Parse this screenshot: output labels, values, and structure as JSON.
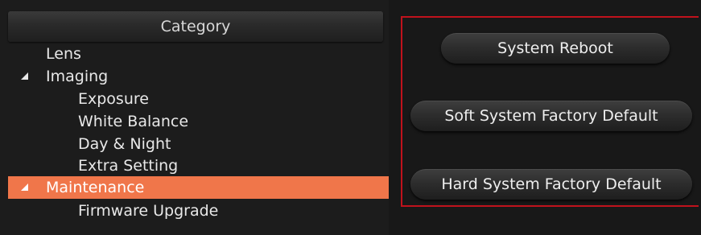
{
  "category": {
    "title": "Category",
    "items": [
      {
        "label": "Lens"
      },
      {
        "label": "Imaging",
        "expanded": true
      },
      {
        "label": "Exposure"
      },
      {
        "label": "White Balance"
      },
      {
        "label": "Day & Night"
      },
      {
        "label": "Extra Setting"
      },
      {
        "label": "Maintenance",
        "expanded": true,
        "selected": true
      },
      {
        "label": "Firmware Upgrade"
      }
    ]
  },
  "actions": {
    "system_reboot": "System Reboot",
    "soft_factory_default": "Soft System Factory Default",
    "hard_factory_default": "Hard System Factory Default"
  },
  "colors": {
    "selected_bg": "#f0764a",
    "highlight_border": "#c0121c"
  }
}
